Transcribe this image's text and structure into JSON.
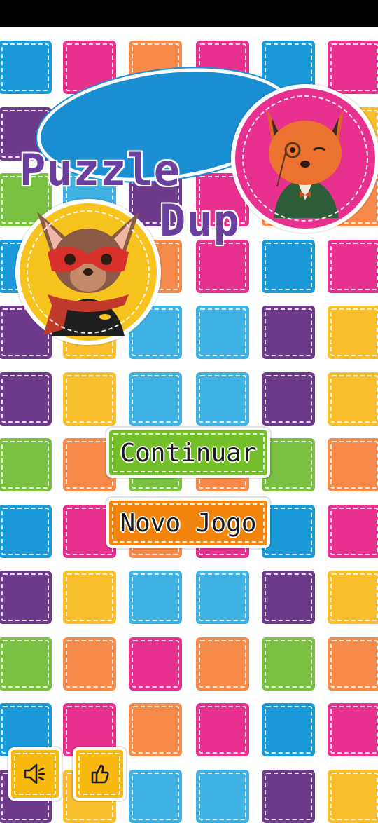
{
  "app": {
    "title_line_1": "Puzzle",
    "title_line_2": "Dup"
  },
  "menu": {
    "continue_label": "Continuar",
    "new_game_label": "Novo Jogo"
  },
  "bottom_bar": {
    "sound_icon": "speaker-icon",
    "rate_icon": "thumbs-up-icon"
  },
  "palette": {
    "blue": "#1a9ad8",
    "magenta": "#e8318f",
    "orange": "#f58a4a",
    "purple": "#6e3b8c",
    "yellow": "#f9be2c",
    "cyan": "#3fb1e3",
    "green": "#7ac143",
    "title_oval": "#1a8fd3",
    "title_text": "#6b3fa0",
    "continue_button": "#72bf2a",
    "new_game_button": "#f2840e"
  },
  "background_rows": [
    [
      "blue",
      "magenta",
      "orange",
      "magenta",
      "blue",
      "magenta"
    ],
    [
      "purple",
      "yellow",
      "cyan",
      "cyan",
      "blue",
      "yellow"
    ],
    [
      "green",
      "cyan",
      "purple",
      "magenta",
      "orange",
      "orange"
    ],
    [
      "blue",
      "orange",
      "orange",
      "magenta",
      "blue",
      "magenta"
    ],
    [
      "purple",
      "yellow",
      "cyan",
      "cyan",
      "purple",
      "yellow"
    ],
    [
      "purple",
      "yellow",
      "cyan",
      "cyan",
      "purple",
      "yellow"
    ],
    [
      "green",
      "orange",
      "green",
      "orange",
      "green",
      "orange"
    ],
    [
      "blue",
      "magenta",
      "orange",
      "magenta",
      "blue",
      "magenta"
    ],
    [
      "purple",
      "yellow",
      "cyan",
      "cyan",
      "purple",
      "yellow"
    ],
    [
      "green",
      "orange",
      "magenta",
      "orange",
      "green",
      "orange"
    ],
    [
      "blue",
      "magenta",
      "orange",
      "magenta",
      "blue",
      "magenta"
    ],
    [
      "purple",
      "yellow",
      "cyan",
      "cyan",
      "purple",
      "yellow"
    ]
  ]
}
